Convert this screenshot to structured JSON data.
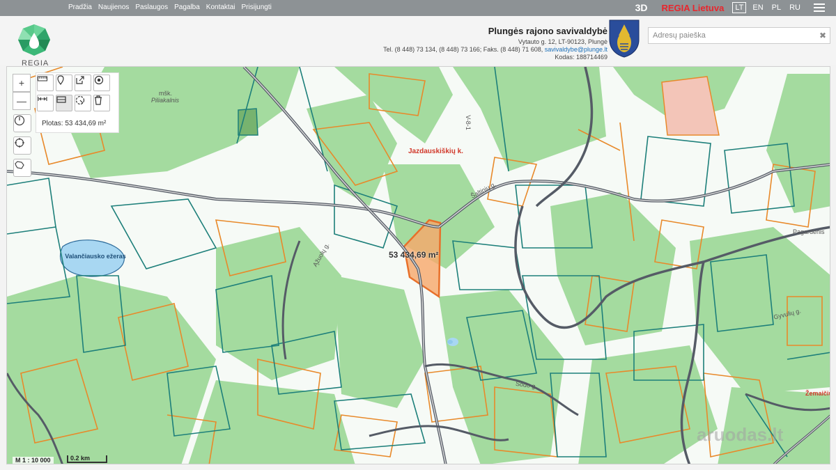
{
  "nav": {
    "items": [
      "Pradžia",
      "Naujienos",
      "Paslaugos",
      "Pagalba",
      "Kontaktai",
      "Prisijungti"
    ],
    "btn_3d": "3D",
    "regia_lietuva": "REGIA Lietuva",
    "languages": [
      "LT",
      "EN",
      "PL",
      "RU"
    ],
    "active_language": "LT"
  },
  "header": {
    "logo_text": "REGIA",
    "municipality": "Plungės rajono savivaldybė",
    "address": "Vytauto g. 12, LT-90123, Plungė",
    "phones": "Tel. (8 448) 73 134, (8 448) 73 166; Faks. (8 448) 71 608,",
    "email": "savivaldybe@plunge.lt",
    "code": "Kodas: 188714469",
    "search_placeholder": "Adresų paieška"
  },
  "map": {
    "area_readout": "Plotas: 53 434,69 m²",
    "polygon_label": "53 434,69 m²",
    "scale_ratio": "M 1 : 10 000",
    "scale_bar": "0.2 km",
    "labels": {
      "forest": "mšk.",
      "hill": "Piliakalnis",
      "village": "Jazdauskiškių k.",
      "lake": "Valančiausko ežeras",
      "road_saltiniu": "Šaltinių g.",
      "road_azuolu": "Ąžuolų g.",
      "road_sodo": "Sodo g.",
      "road_pagardenis": "Pagardenis",
      "road_gyvuliu": "Gyvulių g.",
      "road_zemaitiju": "Žemaičių",
      "road_v": "V-8-1"
    },
    "watermark": "aruodas.lt",
    "colors": {
      "forest": "#9fd89c",
      "parcel_orange": "#e8892a",
      "parcel_teal": "#1d7f7a",
      "road": "#555b66",
      "highlight": "#f7a76a",
      "water": "#a8d7f2",
      "regia_red": "#e8262d"
    }
  }
}
